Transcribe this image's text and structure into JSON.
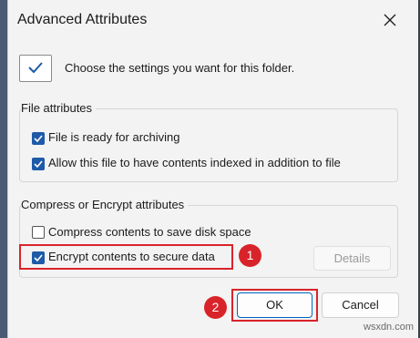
{
  "window": {
    "title": "Advanced Attributes"
  },
  "intro": {
    "text": "Choose the settings you want for this folder."
  },
  "file_attributes": {
    "label": "File attributes",
    "archive": {
      "label": "File is ready for archiving",
      "checked": true
    },
    "index": {
      "label": "Allow this file to have contents indexed in addition to file",
      "checked": true
    }
  },
  "compress_encrypt": {
    "label": "Compress or Encrypt attributes",
    "compress": {
      "label": "Compress contents to save disk space",
      "checked": false
    },
    "encrypt": {
      "label": "Encrypt contents to secure data",
      "checked": true
    },
    "details_label": "Details"
  },
  "buttons": {
    "ok": "OK",
    "cancel": "Cancel"
  },
  "annotations": {
    "step1": "1",
    "step2": "2",
    "highlight_color": "#d9232a"
  },
  "watermark": "wsxdn.com",
  "colors": {
    "accent": "#1f5aa8",
    "ok_border": "#0067c0"
  },
  "icons": {
    "close": "close-icon",
    "folder": "checkmark-icon"
  }
}
